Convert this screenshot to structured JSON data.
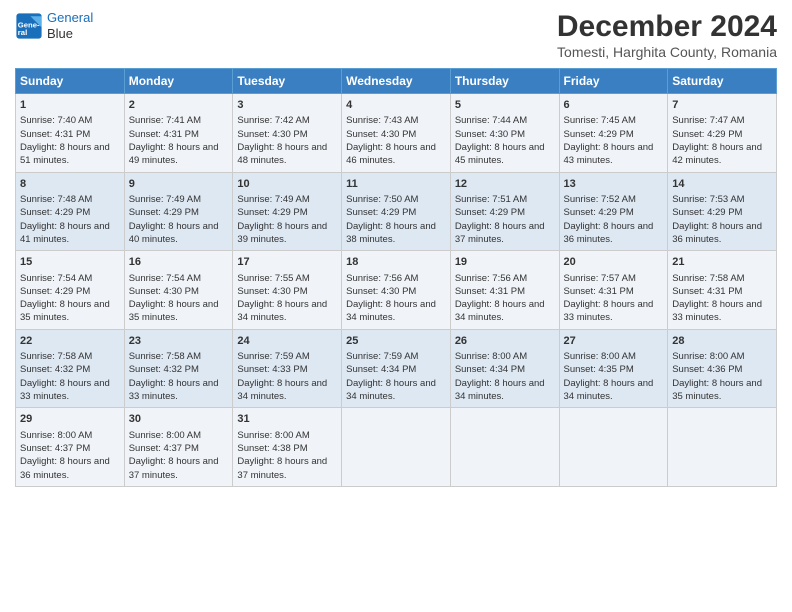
{
  "logo": {
    "line1": "General",
    "line2": "Blue"
  },
  "title": "December 2024",
  "subtitle": "Tomesti, Harghita County, Romania",
  "days_header": [
    "Sunday",
    "Monday",
    "Tuesday",
    "Wednesday",
    "Thursday",
    "Friday",
    "Saturday"
  ],
  "weeks": [
    [
      {
        "day": 1,
        "sunrise": "Sunrise: 7:40 AM",
        "sunset": "Sunset: 4:31 PM",
        "daylight": "Daylight: 8 hours and 51 minutes."
      },
      {
        "day": 2,
        "sunrise": "Sunrise: 7:41 AM",
        "sunset": "Sunset: 4:31 PM",
        "daylight": "Daylight: 8 hours and 49 minutes."
      },
      {
        "day": 3,
        "sunrise": "Sunrise: 7:42 AM",
        "sunset": "Sunset: 4:30 PM",
        "daylight": "Daylight: 8 hours and 48 minutes."
      },
      {
        "day": 4,
        "sunrise": "Sunrise: 7:43 AM",
        "sunset": "Sunset: 4:30 PM",
        "daylight": "Daylight: 8 hours and 46 minutes."
      },
      {
        "day": 5,
        "sunrise": "Sunrise: 7:44 AM",
        "sunset": "Sunset: 4:30 PM",
        "daylight": "Daylight: 8 hours and 45 minutes."
      },
      {
        "day": 6,
        "sunrise": "Sunrise: 7:45 AM",
        "sunset": "Sunset: 4:29 PM",
        "daylight": "Daylight: 8 hours and 43 minutes."
      },
      {
        "day": 7,
        "sunrise": "Sunrise: 7:47 AM",
        "sunset": "Sunset: 4:29 PM",
        "daylight": "Daylight: 8 hours and 42 minutes."
      }
    ],
    [
      {
        "day": 8,
        "sunrise": "Sunrise: 7:48 AM",
        "sunset": "Sunset: 4:29 PM",
        "daylight": "Daylight: 8 hours and 41 minutes."
      },
      {
        "day": 9,
        "sunrise": "Sunrise: 7:49 AM",
        "sunset": "Sunset: 4:29 PM",
        "daylight": "Daylight: 8 hours and 40 minutes."
      },
      {
        "day": 10,
        "sunrise": "Sunrise: 7:49 AM",
        "sunset": "Sunset: 4:29 PM",
        "daylight": "Daylight: 8 hours and 39 minutes."
      },
      {
        "day": 11,
        "sunrise": "Sunrise: 7:50 AM",
        "sunset": "Sunset: 4:29 PM",
        "daylight": "Daylight: 8 hours and 38 minutes."
      },
      {
        "day": 12,
        "sunrise": "Sunrise: 7:51 AM",
        "sunset": "Sunset: 4:29 PM",
        "daylight": "Daylight: 8 hours and 37 minutes."
      },
      {
        "day": 13,
        "sunrise": "Sunrise: 7:52 AM",
        "sunset": "Sunset: 4:29 PM",
        "daylight": "Daylight: 8 hours and 36 minutes."
      },
      {
        "day": 14,
        "sunrise": "Sunrise: 7:53 AM",
        "sunset": "Sunset: 4:29 PM",
        "daylight": "Daylight: 8 hours and 36 minutes."
      }
    ],
    [
      {
        "day": 15,
        "sunrise": "Sunrise: 7:54 AM",
        "sunset": "Sunset: 4:29 PM",
        "daylight": "Daylight: 8 hours and 35 minutes."
      },
      {
        "day": 16,
        "sunrise": "Sunrise: 7:54 AM",
        "sunset": "Sunset: 4:30 PM",
        "daylight": "Daylight: 8 hours and 35 minutes."
      },
      {
        "day": 17,
        "sunrise": "Sunrise: 7:55 AM",
        "sunset": "Sunset: 4:30 PM",
        "daylight": "Daylight: 8 hours and 34 minutes."
      },
      {
        "day": 18,
        "sunrise": "Sunrise: 7:56 AM",
        "sunset": "Sunset: 4:30 PM",
        "daylight": "Daylight: 8 hours and 34 minutes."
      },
      {
        "day": 19,
        "sunrise": "Sunrise: 7:56 AM",
        "sunset": "Sunset: 4:31 PM",
        "daylight": "Daylight: 8 hours and 34 minutes."
      },
      {
        "day": 20,
        "sunrise": "Sunrise: 7:57 AM",
        "sunset": "Sunset: 4:31 PM",
        "daylight": "Daylight: 8 hours and 33 minutes."
      },
      {
        "day": 21,
        "sunrise": "Sunrise: 7:58 AM",
        "sunset": "Sunset: 4:31 PM",
        "daylight": "Daylight: 8 hours and 33 minutes."
      }
    ],
    [
      {
        "day": 22,
        "sunrise": "Sunrise: 7:58 AM",
        "sunset": "Sunset: 4:32 PM",
        "daylight": "Daylight: 8 hours and 33 minutes."
      },
      {
        "day": 23,
        "sunrise": "Sunrise: 7:58 AM",
        "sunset": "Sunset: 4:32 PM",
        "daylight": "Daylight: 8 hours and 33 minutes."
      },
      {
        "day": 24,
        "sunrise": "Sunrise: 7:59 AM",
        "sunset": "Sunset: 4:33 PM",
        "daylight": "Daylight: 8 hours and 34 minutes."
      },
      {
        "day": 25,
        "sunrise": "Sunrise: 7:59 AM",
        "sunset": "Sunset: 4:34 PM",
        "daylight": "Daylight: 8 hours and 34 minutes."
      },
      {
        "day": 26,
        "sunrise": "Sunrise: 8:00 AM",
        "sunset": "Sunset: 4:34 PM",
        "daylight": "Daylight: 8 hours and 34 minutes."
      },
      {
        "day": 27,
        "sunrise": "Sunrise: 8:00 AM",
        "sunset": "Sunset: 4:35 PM",
        "daylight": "Daylight: 8 hours and 34 minutes."
      },
      {
        "day": 28,
        "sunrise": "Sunrise: 8:00 AM",
        "sunset": "Sunset: 4:36 PM",
        "daylight": "Daylight: 8 hours and 35 minutes."
      }
    ],
    [
      {
        "day": 29,
        "sunrise": "Sunrise: 8:00 AM",
        "sunset": "Sunset: 4:37 PM",
        "daylight": "Daylight: 8 hours and 36 minutes."
      },
      {
        "day": 30,
        "sunrise": "Sunrise: 8:00 AM",
        "sunset": "Sunset: 4:37 PM",
        "daylight": "Daylight: 8 hours and 37 minutes."
      },
      {
        "day": 31,
        "sunrise": "Sunrise: 8:00 AM",
        "sunset": "Sunset: 4:38 PM",
        "daylight": "Daylight: 8 hours and 37 minutes."
      },
      null,
      null,
      null,
      null
    ]
  ]
}
